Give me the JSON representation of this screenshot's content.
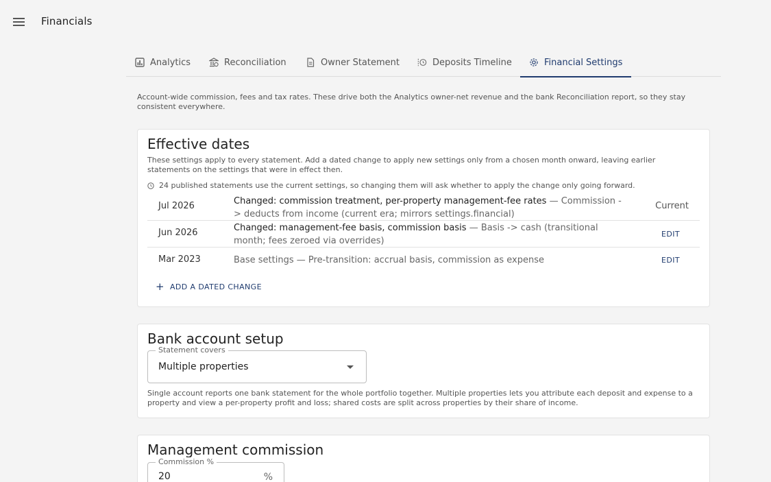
{
  "app": {
    "title": "Financials"
  },
  "tabs": [
    {
      "label": "Analytics",
      "icon": "bar-chart-icon"
    },
    {
      "label": "Reconciliation",
      "icon": "bank-icon"
    },
    {
      "label": "Owner Statement",
      "icon": "document-icon"
    },
    {
      "label": "Deposits Timeline",
      "icon": "timeline-history-icon"
    },
    {
      "label": "Financial Settings",
      "icon": "gear-icon",
      "active": true
    }
  ],
  "intro": "Account-wide commission, fees and tax rates. These drive both the Analytics owner-net revenue and the bank Reconciliation report, so they stay consistent everywhere.",
  "effective_dates": {
    "title": "Effective dates",
    "description": "These settings apply to every statement. Add a dated change to apply new settings only from a chosen month onward, leaving earlier statements on the settings that were in effect then.",
    "note": "24 published statements use the current settings, so changing them will ask whether to apply the change only going forward.",
    "rows": [
      {
        "date": "Jul 2026",
        "changed": "Changed: commission treatment, per-property management-fee rates",
        "detail": " — Commission -> deducts from income (current era; mirrors settings.financial)",
        "status": "Current"
      },
      {
        "date": "Jun 2026",
        "changed": "Changed: management-fee basis, commission basis",
        "detail": " — Basis -> cash (transitional month; fees zeroed via overrides)",
        "action": "EDIT"
      },
      {
        "date": "Mar 2023",
        "changed": "",
        "detail": "Base settings — Pre-transition: accrual basis, commission as expense",
        "action": "EDIT"
      }
    ],
    "add_label": "ADD A DATED CHANGE"
  },
  "bank_setup": {
    "title": "Bank account setup",
    "select_label": "Statement covers",
    "select_value": "Multiple properties",
    "help": "Single account reports one bank statement for the whole portfolio together. Multiple properties lets you attribute each deposit and expense to a property and view a per-property profit and loss; shared costs are split across properties by their share of income."
  },
  "commission": {
    "title": "Management commission",
    "field_label": "Commission %",
    "value": "20",
    "unit": "%"
  },
  "colors": {
    "accent": "#1f3b6e",
    "background": "#f4f4f4",
    "card": "#ffffff"
  }
}
